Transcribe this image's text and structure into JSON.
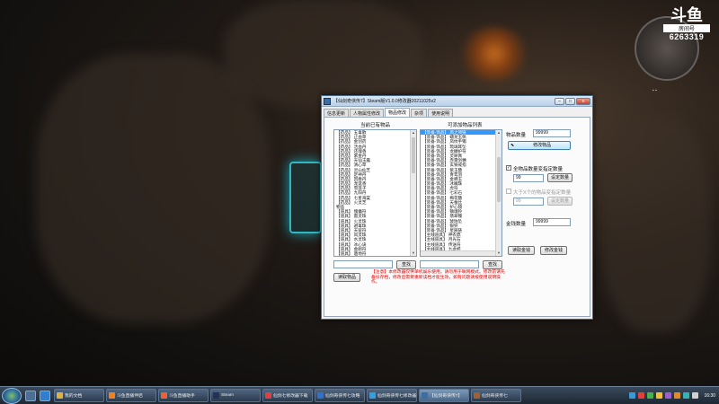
{
  "streamer": {
    "logo_glyph": "斗鱼",
    "room_label": "房间号",
    "room_id": "6263319"
  },
  "window": {
    "title": "【仙剑奇侠传7】Steam版V1.0.0修改器20211025v2",
    "btn_min": "–",
    "btn_max": "□",
    "btn_close": "x"
  },
  "tabs": [
    {
      "label": "信息更新"
    },
    {
      "label": "人物属性修改"
    },
    {
      "label": "物品修改"
    },
    {
      "label": "杂项"
    },
    {
      "label": "使用说明"
    }
  ],
  "left_list": {
    "title": "当前已有物品",
    "items": [
      "【药品】 五毒散",
      "【药品】 止血草",
      "【药品】 金创药",
      "【药品】 活血丹",
      "【药品】 还魂香",
      "【药品】 紫金丹",
      "【药品】 天仙玉露",
      "【药品】 清心草",
      "【药品】 灵山仙芝",
      "【药品】 定神丹",
      "【药品】 回春丹",
      "【药品】 龙涎香",
      "【药品】 雪莲子",
      "【药品】 九阳丹",
      "【药品】 七星海棠",
      "【药品】 火灵芝",
      "物品",
      "【道具】 傀儡符",
      "【道具】 雷灵珠",
      "【道具】 火灵珠",
      "【道具】 避毒珠",
      "【道具】 天罡符",
      "【道具】 风灵珠",
      "【道具】 水灵珠",
      "【道具】 冰心诀",
      "【道具】 金刚符",
      "【道具】 遁地符"
    ]
  },
  "right_list": {
    "title": "可添加物品列表",
    "items": [
      "【装备·饰品】 风之项链",
      "【装备·饰品】 蟠龙玉佩",
      "【装备·饰品】 凤纹手镯",
      "【装备·饰品】 琉璃耳坠",
      "【装备·饰品】 龙鳞护符",
      "【装备·饰品】 灵犀佩",
      "【装备·饰品】 赤霄剑穗",
      "【装备·饰品】 玄铁戒指",
      "【装备·饰品】 紫玉簪",
      "【装备·饰品】 青鸾羽",
      "【装备·饰品】 金蝉玉",
      "【装备·饰品】 冰魄珠",
      "【装备·饰品】 虎符",
      "【装备·饰品】 七彩石",
      "【装备·饰品】 梅花簪",
      "【装备·饰品】 天蚕丝",
      "【装备·饰品】 护心镜",
      "【装备·饰品】 镇魂铃",
      "【装备·饰品】 翡翠镯",
      "【装备·饰品】 琥珀坠",
      "【装备·饰品】 银铃",
      "【装备·饰品】 星辰链",
      "【主线道具】 神农鼎",
      "【主线道具】 月光石",
      "【主线道具】 传送符",
      "【主线道具】 九龙杯",
      "【主线道具】 镜中花"
    ]
  },
  "search_left": {
    "value": "",
    "button": "查找"
  },
  "search_right": {
    "value": "",
    "button": "查找"
  },
  "read_items_button": "读取物品",
  "warning_text": "【注意】本修改器仅供单机娱乐使用，请勿用于联网模式。修改前请先备份存档，修改后需要重新读档才能生效，如有问题请按使用说明操作。",
  "item_quantity": {
    "label": "物品数量",
    "value": "99999",
    "button": "修改物品"
  },
  "all_quantity": {
    "checked": true,
    "check_mark": "✓",
    "label": "全物品数量变指定数量",
    "value": "99",
    "button": "设定数量"
  },
  "greater_quantity": {
    "checked": false,
    "check_mark": "",
    "label": "大于X个的物品变指定数量",
    "value": "99",
    "button": "设定数量"
  },
  "gold": {
    "label": "金钱数量",
    "value": "99999",
    "read_button": "读取金钱",
    "modify_button": "修改金钱"
  },
  "taskbar": {
    "tasks": [
      {
        "label": "我的文档",
        "color": "#e0b040"
      },
      {
        "label": "斗鱼直播伴侣",
        "color": "#f08020"
      },
      {
        "label": "斗鱼直播助手",
        "color": "#f06030"
      },
      {
        "label": "Steam",
        "color": "#223355"
      },
      {
        "label": "仙剑七修改器下载",
        "color": "#e04040"
      },
      {
        "label": "仙剑奇侠传七攻略",
        "color": "#3070d0"
      },
      {
        "label": "仙剑奇侠传七修改器",
        "color": "#30a0e0"
      },
      {
        "label": "【仙剑奇侠传7】",
        "color": "#3a6ea5"
      },
      {
        "label": "仙剑奇侠传七",
        "color": "#a06030"
      }
    ],
    "tray_colors": [
      "#3a9ad9",
      "#e04040",
      "#4caf50",
      "#f0c040",
      "#9c5fd0",
      "#e08a30",
      "#3ab0b0",
      "#d0d0d0"
    ],
    "clock": "16:30"
  }
}
